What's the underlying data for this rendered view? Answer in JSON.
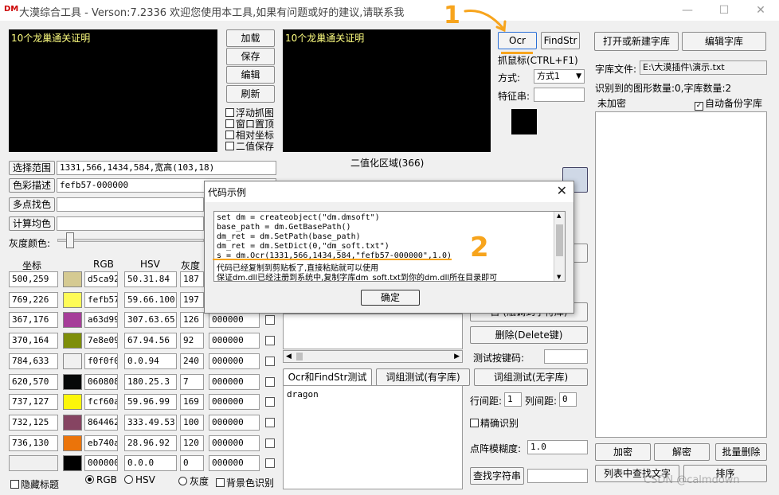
{
  "window": {
    "logo": "DM",
    "title": "大漠综合工具 - Verson:7.2336 欢迎您使用本工具,如果有问题或好的建议,请联系我",
    "min": "—",
    "max": "☐",
    "close": "✕"
  },
  "left_preview": {
    "text": "10个龙巢通关证明"
  },
  "mid_preview": {
    "text": "10个龙巢通关证明"
  },
  "left_buttons": {
    "load": "加载",
    "save": "保存",
    "edit": "编辑",
    "refresh": "刷新"
  },
  "left_checks": {
    "float_capture": "浮动抓图",
    "window_top": "窗口置顶",
    "relative_coords": "相对坐标",
    "binary_save": "二值保存"
  },
  "top_buttons": {
    "ocr": "Ocr",
    "findstr": "FindStr",
    "open_dict": "打开或新建字库",
    "edit_dict": "编辑字库"
  },
  "capture": {
    "mouse_label": "抓鼠标(CTRL+F1)",
    "mode_label": "方式:",
    "mode_value": "方式1",
    "feature_label": "特征串:"
  },
  "dict": {
    "file_label": "字库文件:",
    "file_value": "E:\\大漠插件\\演示.txt",
    "stats": "识别到的图形数量:0,字库数量:2",
    "encrypt_status": "未加密",
    "auto_backup": "自动备份字库"
  },
  "range": {
    "select_btn": "选择范围",
    "select_value": "1331,566,1434,584,宽高(103,18)",
    "color_btn": "色彩描述",
    "color_value": "fefb57-000000",
    "multi_btn": "多点找色",
    "avg_btn": "计算均色",
    "gray_label": "灰度颜色:",
    "binary_region": "二值化区域(366)"
  },
  "table": {
    "headers": {
      "coord": "坐标",
      "rgb": "RGB",
      "hsv": "HSV",
      "gray": "灰度"
    },
    "rows": [
      {
        "coord": "500,259",
        "color": "#d5ca92",
        "rgb": "d5ca92",
        "hsv": "50.31.84",
        "gray": "187",
        "val": ""
      },
      {
        "coord": "769,226",
        "color": "#fefb57",
        "rgb": "fefb57",
        "hsv": "59.66.100",
        "gray": "197",
        "val": ""
      },
      {
        "coord": "367,176",
        "color": "#a63d99",
        "rgb": "a63d99",
        "hsv": "307.63.65",
        "gray": "126",
        "val": "000000"
      },
      {
        "coord": "370,164",
        "color": "#7e8e09",
        "rgb": "7e8e09",
        "hsv": "67.94.56",
        "gray": "92",
        "val": "000000"
      },
      {
        "coord": "784,633",
        "color": "#f0f0f0",
        "rgb": "f0f0f0",
        "hsv": "0.0.94",
        "gray": "240",
        "val": "000000"
      },
      {
        "coord": "620,570",
        "color": "#060808",
        "rgb": "060808",
        "hsv": "180.25.3",
        "gray": "7",
        "val": "000000"
      },
      {
        "coord": "737,127",
        "color": "#fcf60a",
        "rgb": "fcf60a",
        "hsv": "59.96.99",
        "gray": "169",
        "val": "000000"
      },
      {
        "coord": "732,125",
        "color": "#864462",
        "rgb": "864462",
        "hsv": "333.49.53",
        "gray": "100",
        "val": "000000"
      },
      {
        "coord": "736,130",
        "color": "#eb740a",
        "rgb": "eb740a",
        "hsv": "28.96.92",
        "gray": "120",
        "val": "000000"
      },
      {
        "coord": "",
        "color": "#000000",
        "rgb": "000000",
        "hsv": "0.0.0",
        "gray": "0",
        "val": "000000"
      }
    ]
  },
  "bottom_left": {
    "hide_title": "隐藏标题",
    "rgb": "RGB",
    "hsv": "HSV",
    "gray": "灰度",
    "bg_recognize": "背景色识别"
  },
  "mid_panel": {
    "tab_ocr": "Ocr和FindStr测试",
    "tab_group_dict": "词组测试(有字库)",
    "tab_group_nodict": "词组测试(无字库)",
    "result": "dragon",
    "hidden_btn": "自 (瓶调到字符库)",
    "scroll_left": "◀",
    "scroll_right": "▶"
  },
  "right_panel": {
    "delete_btn": "删除(Delete键)",
    "test_key_label": "测试按键码:",
    "row_gap_label": "行间距:",
    "row_gap_value": "1",
    "col_gap_label": "列间距:",
    "col_gap_value": "0",
    "exact": "精确识别",
    "blur_label": "点阵模糊度:",
    "blur_value": "1.0",
    "find_char_btn": "查找字符串",
    "encrypt_btn": "加密",
    "decrypt_btn": "解密",
    "batch_delete_btn": "批量删除",
    "list_find_btn": "列表中查找文字",
    "sort_btn": "排序"
  },
  "dialog": {
    "title": "代码示例",
    "close": "✕",
    "lines": [
      "set dm = createobject(\"dm.dmsoft\")",
      "base_path = dm.GetBasePath()",
      "dm_ret = dm.SetPath(base_path)",
      "dm_ret = dm.SetDict(0,\"dm_soft.txt\")",
      "s = dm.Ocr(1331,566,1434,584,\"fefb57-000000\",1.0)",
      "代码已经复制到剪贴板了,直接粘贴就可以使用",
      "保证dm.dll已经注册到系统中,复制字库dm_soft.txt到你的dm.dll所在目录即可"
    ],
    "ok": "确定",
    "scroll_up": "▲",
    "scroll_down": "▼"
  },
  "annotations": {
    "one": "1",
    "two": "2"
  },
  "watermark": "CSDN @calmdown",
  "colors": {
    "accent_orange": "#f7a41c",
    "window_bg": "#f0f0f0",
    "preview_bg": "#000000"
  }
}
